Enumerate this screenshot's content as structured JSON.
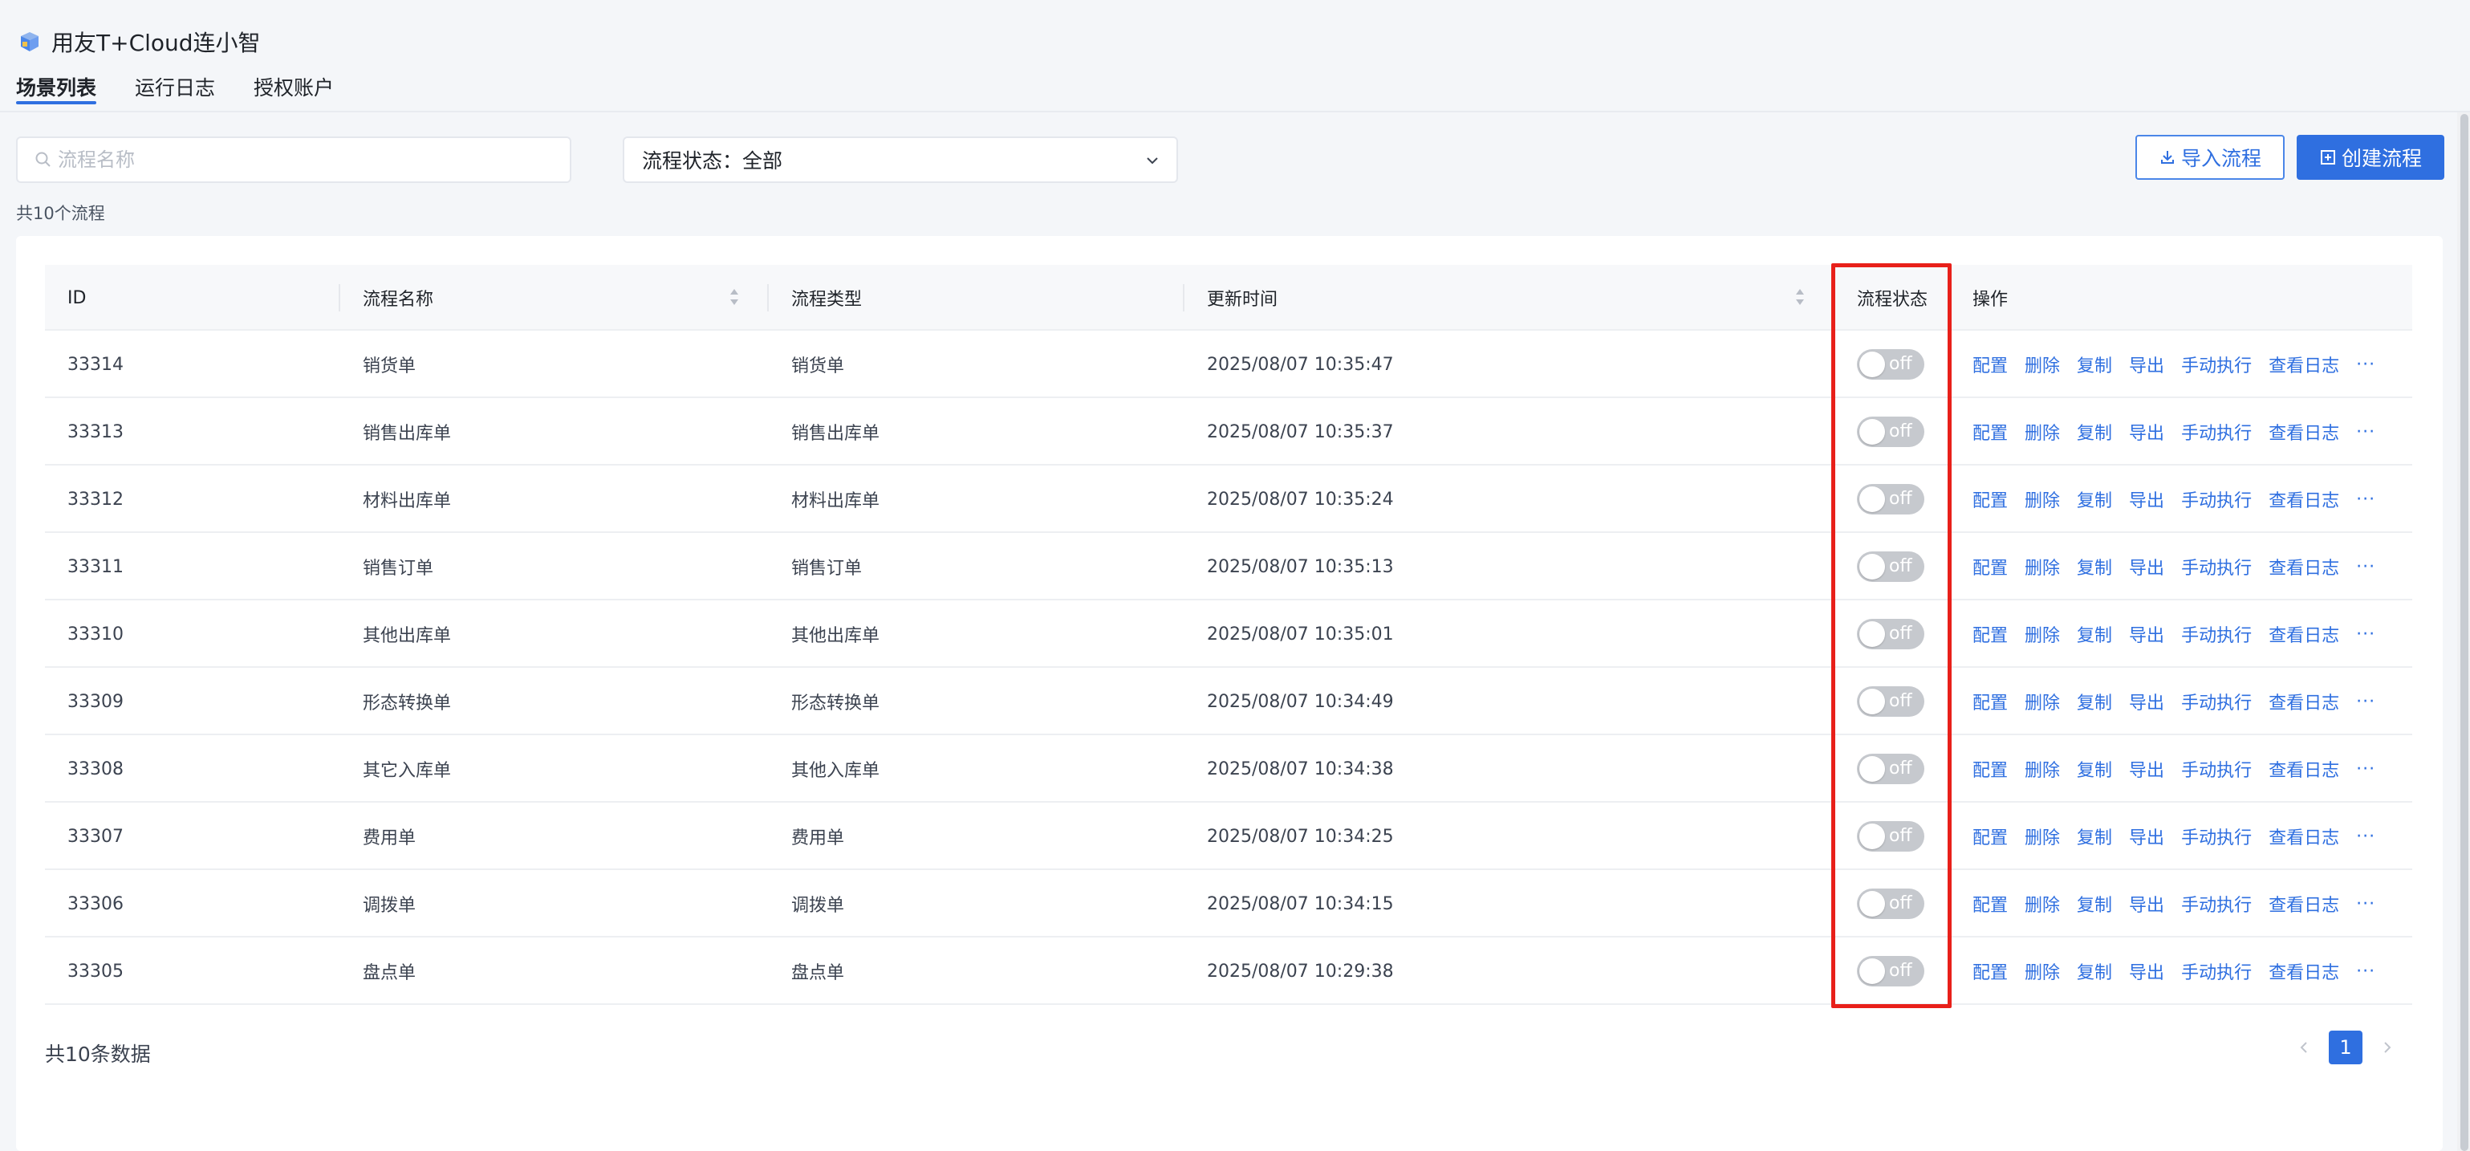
{
  "app": {
    "title": "用友T+Cloud连小智",
    "logo_icon": "cube-logo-icon"
  },
  "tabs": [
    {
      "label": "场景列表",
      "active": true
    },
    {
      "label": "运行日志",
      "active": false
    },
    {
      "label": "授权账户",
      "active": false
    }
  ],
  "toolbar": {
    "search_placeholder": "流程名称",
    "search_value": "",
    "status_filter_label": "流程状态：全部",
    "import_label": "导入流程",
    "create_label": "创建流程"
  },
  "summary": {
    "flow_count": "共10个流程",
    "data_count": "共10条数据"
  },
  "table": {
    "headers": {
      "id": "ID",
      "name": "流程名称",
      "type": "流程类型",
      "updated": "更新时间",
      "status": "流程状态",
      "actions": "操作"
    },
    "rows": [
      {
        "id": "33314",
        "name": "销货单",
        "type": "销货单",
        "updated": "2025/08/07 10:35:47",
        "status": "off"
      },
      {
        "id": "33313",
        "name": "销售出库单",
        "type": "销售出库单",
        "updated": "2025/08/07 10:35:37",
        "status": "off"
      },
      {
        "id": "33312",
        "name": "材料出库单",
        "type": "材料出库单",
        "updated": "2025/08/07 10:35:24",
        "status": "off"
      },
      {
        "id": "33311",
        "name": "销售订单",
        "type": "销售订单",
        "updated": "2025/08/07 10:35:13",
        "status": "off"
      },
      {
        "id": "33310",
        "name": "其他出库单",
        "type": "其他出库单",
        "updated": "2025/08/07 10:35:01",
        "status": "off"
      },
      {
        "id": "33309",
        "name": "形态转换单",
        "type": "形态转换单",
        "updated": "2025/08/07 10:34:49",
        "status": "off"
      },
      {
        "id": "33308",
        "name": "其它入库单",
        "type": "其他入库单",
        "updated": "2025/08/07 10:34:38",
        "status": "off"
      },
      {
        "id": "33307",
        "name": "费用单",
        "type": "费用单",
        "updated": "2025/08/07 10:34:25",
        "status": "off"
      },
      {
        "id": "33306",
        "name": "调拨单",
        "type": "调拨单",
        "updated": "2025/08/07 10:34:15",
        "status": "off"
      },
      {
        "id": "33305",
        "name": "盘点单",
        "type": "盘点单",
        "updated": "2025/08/07 10:29:38",
        "status": "off"
      }
    ],
    "actions": [
      "配置",
      "删除",
      "复制",
      "导出",
      "手动执行",
      "查看日志",
      "···"
    ]
  },
  "pagination": {
    "current_page": "1"
  },
  "colors": {
    "primary": "#2f6fe0",
    "highlight_border": "#e8201a",
    "switch_off": "#c6c9ce"
  }
}
